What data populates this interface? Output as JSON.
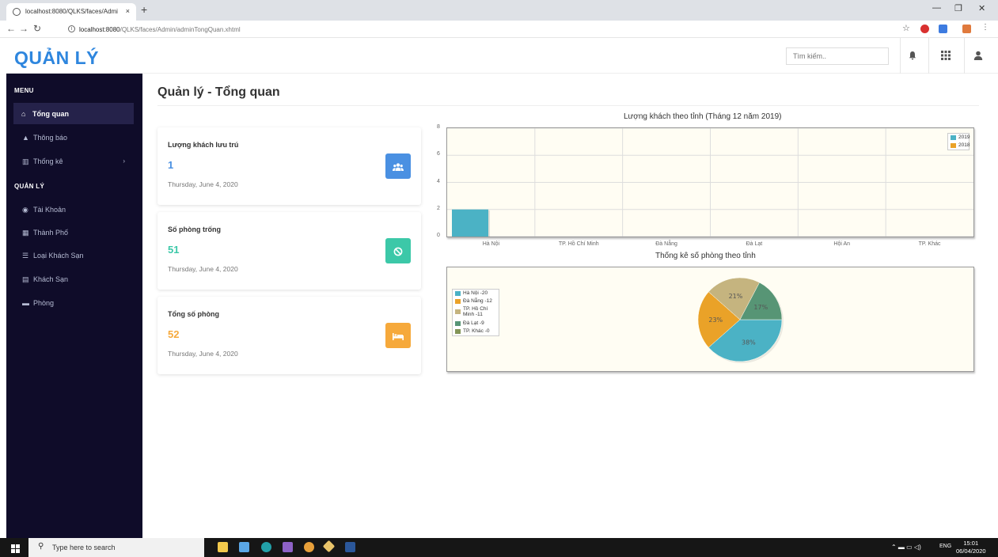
{
  "browser": {
    "tab_title": "localhost:8080/QLKS/faces/Admi",
    "url_host": "localhost:8080",
    "url_path": "/QLKS/faces/Admin/adminTongQuan.xhtml",
    "new_tab": "+",
    "close": "×"
  },
  "header": {
    "brand": "QUẢN LÝ",
    "search_placeholder": "Tìm kiếm.."
  },
  "sidebar": {
    "menu_heading": "MENU",
    "manage_heading": "QUẢN LÝ",
    "items": [
      {
        "label": "Tổng quan",
        "icon": "home-icon"
      },
      {
        "label": "Thông báo",
        "icon": "bell-icon"
      },
      {
        "label": "Thống kê",
        "icon": "chart-icon"
      },
      {
        "label": "Tài Khoản",
        "icon": "user-circle-icon"
      },
      {
        "label": "Thành Phố",
        "icon": "building-icon"
      },
      {
        "label": "Loại Khách Sạn",
        "icon": "list-icon"
      },
      {
        "label": "Khách Sạn",
        "icon": "hotel-icon"
      },
      {
        "label": "Phòng",
        "icon": "bed-icon"
      }
    ]
  },
  "main": {
    "page_title": "Quản lý - Tổng quan",
    "cards": [
      {
        "label": "Lượng khách lưu trú",
        "value": "1",
        "date": "Thursday, June 4, 2020",
        "color": "#4a90e2",
        "icon": "users-icon"
      },
      {
        "label": "Số phòng trống",
        "value": "51",
        "date": "Thursday, June 4, 2020",
        "color": "#3cc8a8",
        "icon": "ban-icon"
      },
      {
        "label": "Tổng số phòng",
        "value": "52",
        "date": "Thursday, June 4, 2020",
        "color": "#f6a93b",
        "icon": "bed-icon"
      }
    ]
  },
  "chart_data": [
    {
      "type": "bar",
      "title": "Lượng khách theo tỉnh (Tháng 12 năm 2019)",
      "categories": [
        "Hà Nội",
        "TP. Hồ Chí Minh",
        "Đà Nẵng",
        "Đà Lạt",
        "Hội An",
        "TP. Khác"
      ],
      "series": [
        {
          "name": "2019",
          "values": [
            2,
            0,
            0,
            0,
            0,
            0
          ],
          "color": "#4bb2c5"
        },
        {
          "name": "2018",
          "values": [
            0,
            0,
            0,
            0,
            0,
            0
          ],
          "color": "#eaa228"
        }
      ],
      "yticks": [
        "0",
        "2",
        "4",
        "6",
        "8"
      ],
      "ylim": [
        0,
        8
      ],
      "legend": "top-right",
      "grid": true
    },
    {
      "type": "pie",
      "title": "Thống kê số phòng theo tỉnh",
      "legend": "left",
      "slices": [
        {
          "label": "Hà Nội -20",
          "value": 20,
          "pct_label": "38%",
          "color": "#4bb2c5"
        },
        {
          "label": "Đà Nẵng -12",
          "value": 12,
          "pct_label": "23%",
          "color": "#eaa228"
        },
        {
          "label": "TP. Hồ Chí Minh -11",
          "value": 11,
          "pct_label": "21%",
          "color": "#c5b47f"
        },
        {
          "label": "Đà Lạt -9",
          "value": 9,
          "pct_label": "17%",
          "color": "#579575"
        },
        {
          "label": "TP. Khác -0",
          "value": 0,
          "pct_label": "",
          "color": "#839557"
        }
      ]
    }
  ],
  "taskbar": {
    "search_placeholder": "Type here to search",
    "lang": "ENG",
    "time": "15:01",
    "date": "06/04/2020"
  }
}
